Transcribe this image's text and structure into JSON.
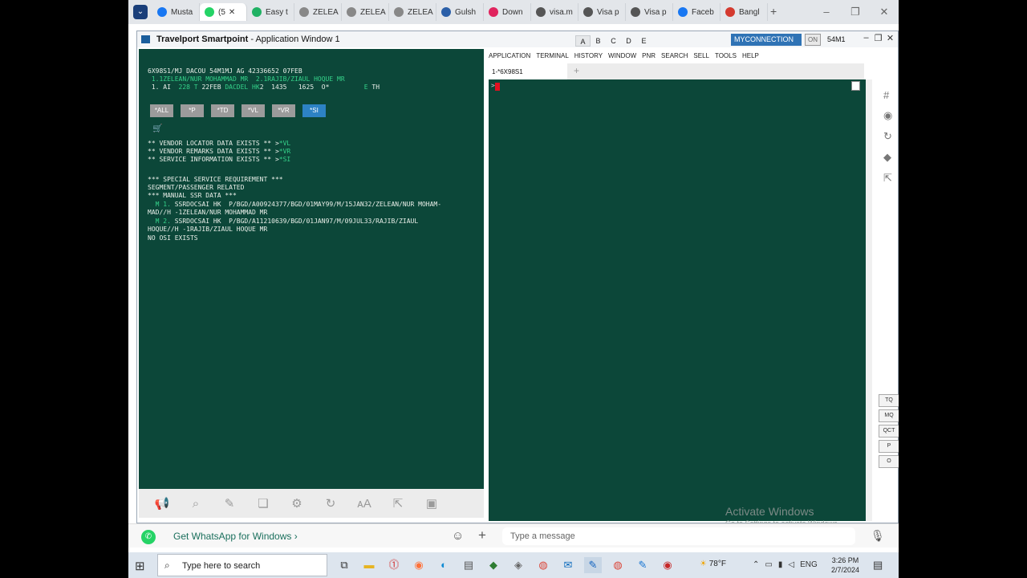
{
  "browser": {
    "tabs": [
      {
        "label": "Musta",
        "icon": "facebook-icon",
        "color": "#1877f2"
      },
      {
        "label": "(5",
        "icon": "whatsapp-icon",
        "color": "#25d366",
        "active": true
      },
      {
        "label": "Easy t",
        "icon": "s-icon",
        "color": "#20b163"
      },
      {
        "label": "ZELEA",
        "icon": "globe-icon",
        "color": "#888888"
      },
      {
        "label": "ZELEA",
        "icon": "globe-icon",
        "color": "#888888"
      },
      {
        "label": "ZELEA",
        "icon": "globe-icon",
        "color": "#888888"
      },
      {
        "label": "Gulsh",
        "icon": "cam-icon",
        "color": "#2b5fa8"
      },
      {
        "label": "Down",
        "icon": "heart-icon",
        "color": "#e0245e"
      },
      {
        "label": "visa.m",
        "icon": "page-icon",
        "color": "#555555"
      },
      {
        "label": "Visa p",
        "icon": "page-icon",
        "color": "#555555"
      },
      {
        "label": "Visa p",
        "icon": "page-icon",
        "color": "#555555"
      },
      {
        "label": "Faceb",
        "icon": "facebook-icon",
        "color": "#1877f2"
      },
      {
        "label": "Bangl",
        "icon": "bangla-icon",
        "color": "#d43a2f"
      }
    ]
  },
  "travelport": {
    "title_bold": "Travelport Smartpoint",
    "title_rest": " - Application Window 1",
    "tabs": [
      "A",
      "B",
      "C",
      "D",
      "E"
    ],
    "connection": "MYCONNECTION",
    "on_label": "ON",
    "pcc": "54M1",
    "menu": [
      "APPLICATION",
      "TERMINAL",
      "HISTORY",
      "WINDOW",
      "PNR",
      "SEARCH",
      "SELL",
      "TOOLS",
      "HELP"
    ],
    "terminal_tab": "1-*6X98S1",
    "prompt": ">",
    "quick_buttons": [
      "*ALL",
      "*P",
      "*TD",
      "*VL",
      "*VR",
      "*SI"
    ],
    "response": {
      "header": "6X98S1/MJ DACOU 54M1MJ AG 42336652 07FEB",
      "names": " 1.1ZELEAN/NUR MOHAMMAD MR  2.1RAJIB/ZIAUL HOQUE MR",
      "seg_num": " 1. AI  ",
      "seg_flight": "228 T",
      "seg_date": " 22FEB ",
      "seg_route": "DACDEL HK",
      "seg_rest": "2  1435   1625  O*         ",
      "seg_e": "E",
      "seg_th": " TH",
      "vl_text": "** VENDOR LOCATOR DATA EXISTS ** >",
      "vl_link": "*VL",
      "vr_text": "** VENDOR REMARKS DATA EXISTS ** >",
      "vr_link": "*VR",
      "si_text": "** SERVICE INFORMATION EXISTS ** >",
      "si_link": "*SI",
      "ssr_title": "*** SPECIAL SERVICE REQUIREMENT ***",
      "ssr_seg": "SEGMENT/PASSENGER RELATED",
      "ssr_manual": "*** MANUAL SSR DATA ***",
      "ssr1_num": "  M 1.",
      "ssr1_a": " SSRDOCSAI HK  P/BGD/A00924377/BGD/01MAY99/M/15JAN32/ZELEAN/NUR MOHAM-",
      "ssr1_b": "MAD//H -1ZELEAN/NUR MOHAMMAD MR",
      "ssr2_num": "  M 2.",
      "ssr2_a": " SSRDOCSAI HK  P/BGD/A11210639/BGD/01JAN97/M/09JUL33/RAJIB/ZIAUL",
      "ssr2_b": "HOQUE//H -1RAJIB/ZIAUL HOQUE MR",
      "osi": "NO OSI EXISTS"
    },
    "side_buttons": [
      "TQ",
      "MQ",
      "QCT",
      "P",
      "O"
    ]
  },
  "watermark": {
    "line1": "Activate Windows",
    "line2": "Go to Settings to activate Windows."
  },
  "whatsapp": {
    "link": "Get WhatsApp for Windows",
    "placeholder": "Type a message"
  },
  "taskbar": {
    "search_placeholder": "Type here to search",
    "weather": "78°F",
    "lang": "ENG",
    "time": "3:26 PM",
    "date": "2/7/2024"
  }
}
